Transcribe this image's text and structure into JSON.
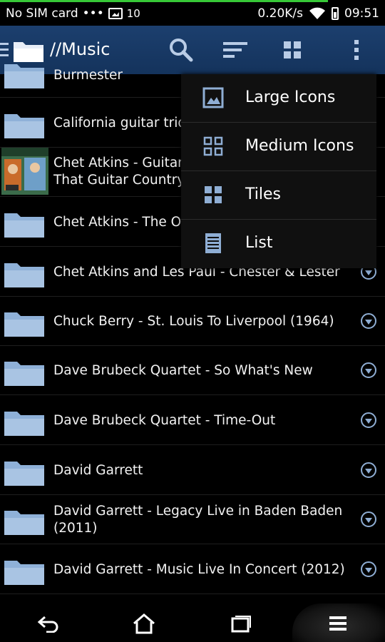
{
  "status_bar": {
    "carrier": "No SIM card",
    "dots": "•••",
    "signal_strength": "10",
    "network_speed": "0.20K/s",
    "time": "09:51",
    "accent_color": "#37c837"
  },
  "toolbar": {
    "title": "//Music",
    "background_color": "#1c3f6e"
  },
  "list": {
    "items": [
      {
        "label": "Burmester",
        "icon": "folder-icon"
      },
      {
        "label": "California guitar trio",
        "icon": "folder-icon"
      },
      {
        "label_line1": "Chet Atkins - Guitar",
        "label_line2": "That Guitar Country",
        "icon": "album-art-thumbnail",
        "thumb_text": "CHET ATKINS"
      },
      {
        "label": "Chet Atkins - The Ot",
        "icon": "folder-icon"
      },
      {
        "label": "Chet Atkins and Les Paul - Chester & Lester",
        "icon": "folder-icon"
      },
      {
        "label": "Chuck Berry - St. Louis To Liverpool (1964)",
        "icon": "folder-icon"
      },
      {
        "label": "Dave Brubeck Quartet - So What's New",
        "icon": "folder-icon"
      },
      {
        "label": "Dave Brubeck Quartet - Time-Out",
        "icon": "folder-icon"
      },
      {
        "label": "David Garrett",
        "icon": "folder-icon"
      },
      {
        "label_line1": "David Garrett - Legacy Live in Baden Baden",
        "label_line2": "(2011)",
        "icon": "folder-icon"
      },
      {
        "label": "David Garrett - Music Live In Concert (2012)",
        "icon": "folder-icon"
      }
    ]
  },
  "view_menu": {
    "items": [
      {
        "label": "Large Icons",
        "icon": "image-icon"
      },
      {
        "label": "Medium Icons",
        "icon": "grid-outline-icon"
      },
      {
        "label": "Tiles",
        "icon": "tiles-icon"
      },
      {
        "label": "List",
        "icon": "list-icon"
      }
    ]
  },
  "colors": {
    "folder": "#8fb1d8",
    "expand_icon": "#8faed4"
  }
}
